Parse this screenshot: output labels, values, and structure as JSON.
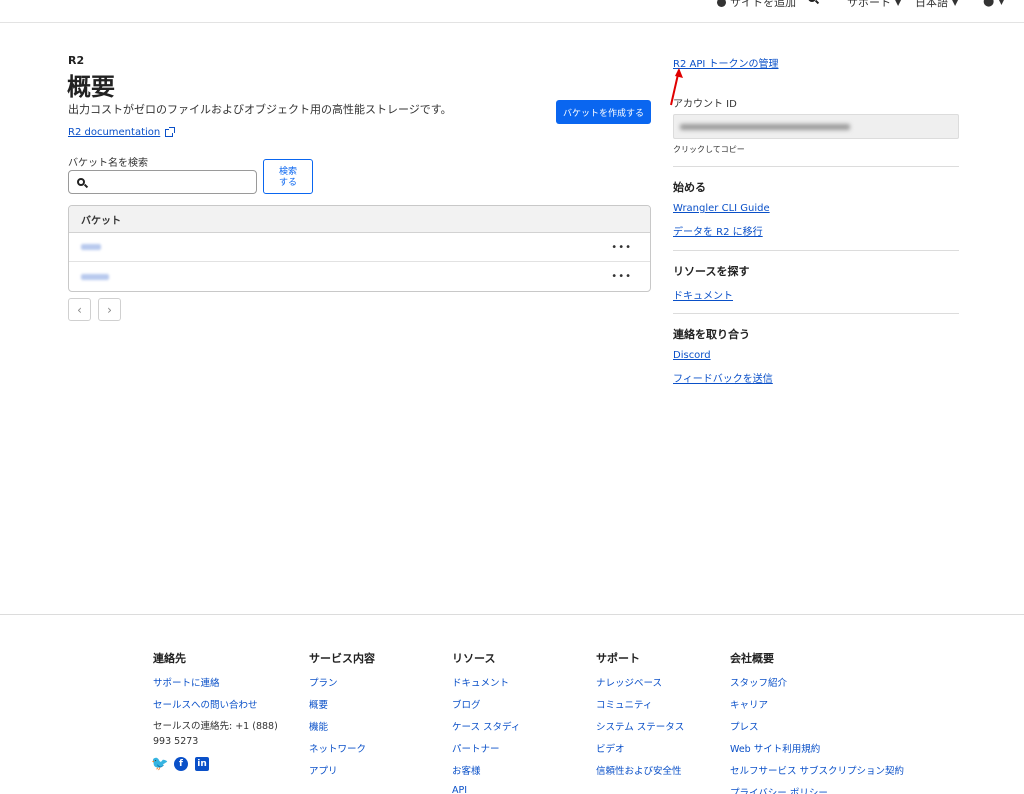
{
  "topbar": {
    "add_site": "サイトを追加",
    "support": "サポート",
    "language": "日本語"
  },
  "main": {
    "eyebrow": "R2",
    "title": "概要",
    "description": "出力コストがゼロのファイルおよびオブジェクト用の高性能ストレージです。",
    "doc_link": "R2 documentation",
    "create_bucket": "バケットを作成する",
    "search_label": "バケット名を検索",
    "search_placeholder": "",
    "search_button": "検索\nする",
    "table_header": "バケット",
    "row_more": "•••"
  },
  "sidebar": {
    "token_link": "R2 API トークンの管理",
    "account_id_label": "アカウント ID",
    "copy_hint": "クリックしてコピー",
    "get_started": {
      "title": "始める",
      "links": [
        "Wrangler CLI Guide",
        "データを R2 に移行"
      ]
    },
    "resources": {
      "title": "リソースを探す",
      "links": [
        "ドキュメント"
      ]
    },
    "contact": {
      "title": "連絡を取り合う",
      "links": [
        "Discord",
        "フィードバックを送信"
      ]
    }
  },
  "footer": {
    "contact": {
      "title": "連絡先",
      "links": [
        "サポートに連絡",
        "セールスへの問い合わせ"
      ],
      "sales_phone": "セールスの連絡先: +1 (888) 993 5273"
    },
    "services": {
      "title": "サービス内容",
      "links": [
        "プラン",
        "概要",
        "機能",
        "ネットワーク",
        "アプリ"
      ]
    },
    "resources": {
      "title": "リソース",
      "links": [
        "ドキュメント",
        "ブログ",
        "ケース スタディ",
        "パートナー",
        "お客様",
        "API"
      ]
    },
    "support": {
      "title": "サポート",
      "links": [
        "ナレッジベース",
        "コミュニティ",
        "システム ステータス",
        "ビデオ",
        "信頼性および安全性"
      ]
    },
    "company": {
      "title": "会社概要",
      "links": [
        "スタッフ紹介",
        "キャリア",
        "プレス",
        "Web サイト利用規約",
        "セルフサービス サブスクリプション契約",
        "プライバシー ポリシー"
      ]
    }
  },
  "colors": {
    "accent": "#0a66f0",
    "link": "#0a50c8",
    "annotation_arrow": "#e00000"
  }
}
